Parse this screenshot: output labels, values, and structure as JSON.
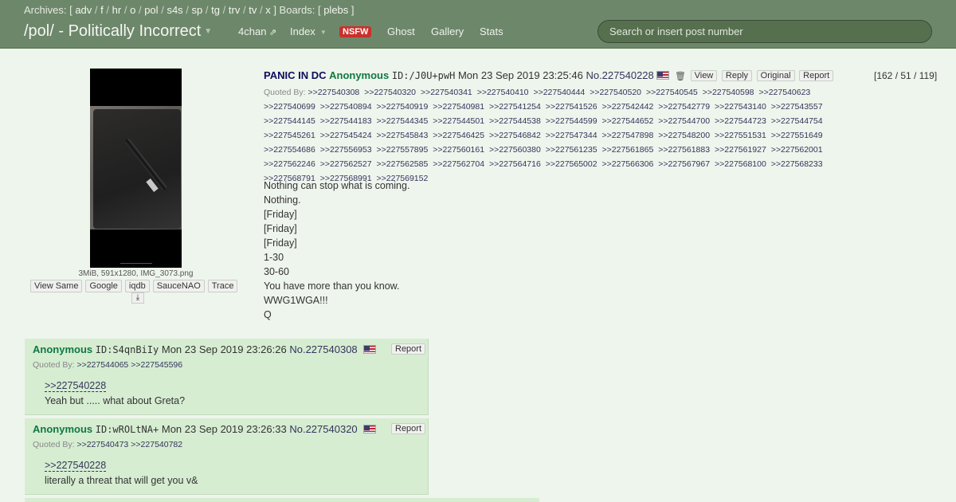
{
  "topbar": {
    "archives_label": "Archives: [",
    "archive_boards": [
      "adv",
      "f",
      "hr",
      "o",
      "pol",
      "s4s",
      "sp",
      "tg",
      "trv",
      "tv",
      "x"
    ],
    "boards_label": "] Boards: [",
    "boards": [
      "plebs"
    ],
    "boards_close": "]",
    "title": "/pol/ - Politically Incorrect",
    "nav": {
      "fourchan": "4chan",
      "index": "Index",
      "nsfw": "NSFW",
      "ghost": "Ghost",
      "gallery": "Gallery",
      "stats": "Stats"
    },
    "search_placeholder": "Search or insert post number"
  },
  "op": {
    "file_info": "3MiB, 591x1280, IMG_3073.png",
    "image_tools": [
      "View Same",
      "Google",
      "iqdb",
      "SauceNAO",
      "Trace"
    ],
    "subject": "PANIC IN DC",
    "name": "Anonymous",
    "id": "ID:/J0U+pwH",
    "date": "Mon 23 Sep 2019 23:25:46",
    "number": "No.227540228",
    "actions": [
      "View",
      "Reply",
      "Original",
      "Report"
    ],
    "counts": "[162 / 51 / 119]",
    "quoted_by_label": "Quoted By:",
    "quoted_by": [
      ">>227540308",
      ">>227540320",
      ">>227540341",
      ">>227540410",
      ">>227540444",
      ">>227540520",
      ">>227540545",
      ">>227540598",
      ">>227540623",
      ">>227540699",
      ">>227540894",
      ">>227540919",
      ">>227540981",
      ">>227541254",
      ">>227541526",
      ">>227542442",
      ">>227542779",
      ">>227543140",
      ">>227543557",
      ">>227544145",
      ">>227544183",
      ">>227544345",
      ">>227544501",
      ">>227544538",
      ">>227544599",
      ">>227544652",
      ">>227544700",
      ">>227544723",
      ">>227544754",
      ">>227545261",
      ">>227545424",
      ">>227545843",
      ">>227546425",
      ">>227546842",
      ">>227547344",
      ">>227547898",
      ">>227548200",
      ">>227551531",
      ">>227551649",
      ">>227554686",
      ">>227556953",
      ">>227557895",
      ">>227560161",
      ">>227560380",
      ">>227561235",
      ">>227561865",
      ">>227561883",
      ">>227561927",
      ">>227562001",
      ">>227562246",
      ">>227562527",
      ">>227562585",
      ">>227562704",
      ">>227564716",
      ">>227565002",
      ">>227566306",
      ">>227567967",
      ">>227568100",
      ">>227568233",
      ">>227568791",
      ">>227568991",
      ">>227569152"
    ],
    "body": [
      "Nothing can stop what is coming.",
      "Nothing.",
      "[Friday]",
      "[Friday]",
      "[Friday]",
      "1-30",
      "30-60",
      "You have more than you know.",
      "WWG1WGA!!!",
      "Q"
    ]
  },
  "replies": [
    {
      "name": "Anonymous",
      "id": "ID:S4qnBiIy",
      "date": "Mon 23 Sep 2019 23:26:26",
      "no_label": "No.",
      "number": "227540308",
      "report": "Report",
      "quoted_by_label": "Quoted By:",
      "quoted_by": [
        ">>227544065",
        ">>227545596"
      ],
      "quote_link": ">>227540228",
      "text": "Yeah but ..... what about Greta?"
    },
    {
      "name": "Anonymous",
      "id": "ID:wROLtNA+",
      "date": "Mon 23 Sep 2019 23:26:33",
      "no_label": "No.",
      "number": "227540320",
      "report": "Report",
      "quoted_by_label": "Quoted By:",
      "quoted_by": [
        ">>227540473",
        ">>227540782"
      ],
      "quote_link": ">>227540228",
      "text": "literally a threat that will get you v&"
    }
  ],
  "colors": {
    "topbar": "#6d876a",
    "background": "#eef5ec",
    "reply": "#d6edd1",
    "name": "#117743",
    "subject": "#0f0c5d",
    "nsfw": "#c9302c"
  }
}
